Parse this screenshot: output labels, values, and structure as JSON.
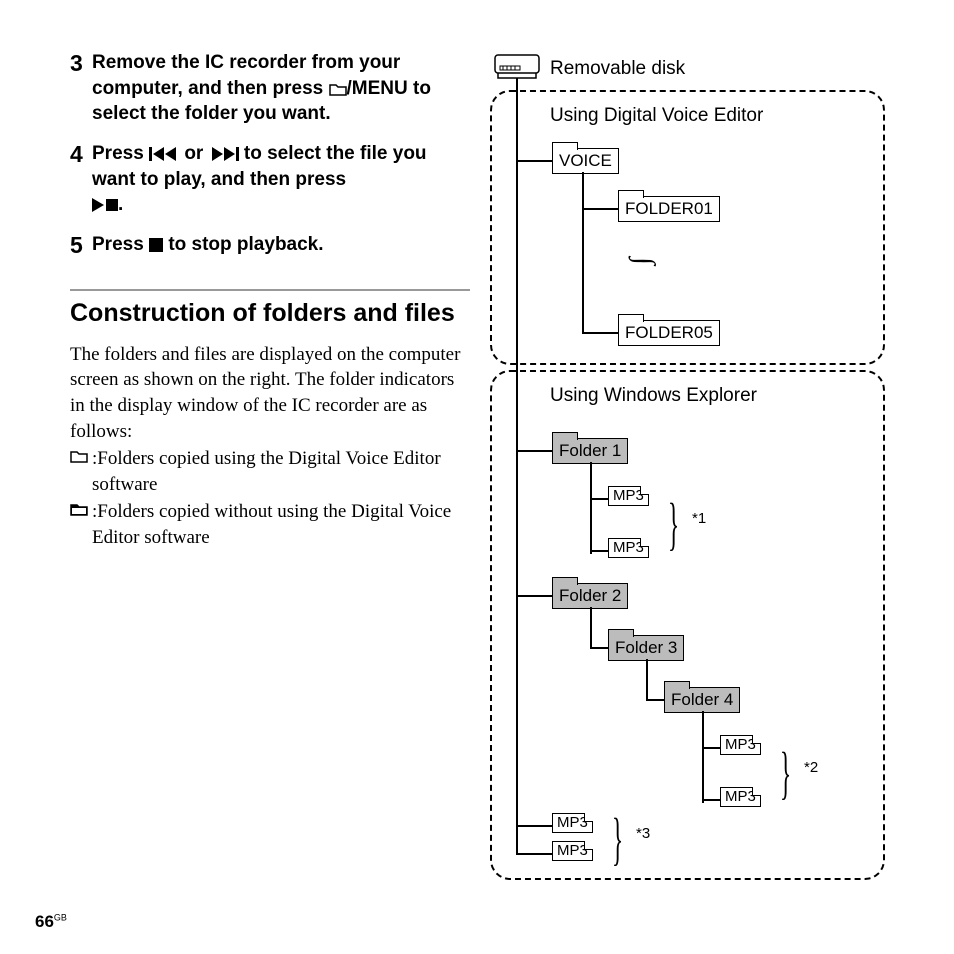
{
  "steps": {
    "s3": {
      "num": "3",
      "text_a": "Remove the IC recorder from your computer, and then press ",
      "text_b": "/MENU to select the folder you want."
    },
    "s4": {
      "num": "4",
      "text_a": "Press ",
      "text_b": " or ",
      "text_c": " to select the file you want to play, and then press ",
      "text_d": "."
    },
    "s5": {
      "num": "5",
      "text_a": "Press ",
      "text_b": " to stop playback."
    }
  },
  "section_title": "Construction of folders and files",
  "body": "The folders and files are displayed on the computer screen as shown on the right. The folder indicators in the display window of the IC recorder are as follows:",
  "legend": {
    "a": ":Folders copied using the Digital Voice Editor software",
    "b": ":Folders copied without using the Digital Voice Editor software"
  },
  "diagram": {
    "disk_label": "Removable disk",
    "group_dve": "Using Digital Voice Editor",
    "group_win": "Using Windows Explorer",
    "voice": "VOICE",
    "folder01": "FOLDER01",
    "folder05": "FOLDER05",
    "folder1": "Folder 1",
    "folder2": "Folder 2",
    "folder3": "Folder 3",
    "folder4": "Folder 4",
    "mp3": "MP3",
    "note1": "*1",
    "note2": "*2",
    "note3": "*3"
  },
  "page": {
    "num": "66",
    "region": "GB"
  }
}
